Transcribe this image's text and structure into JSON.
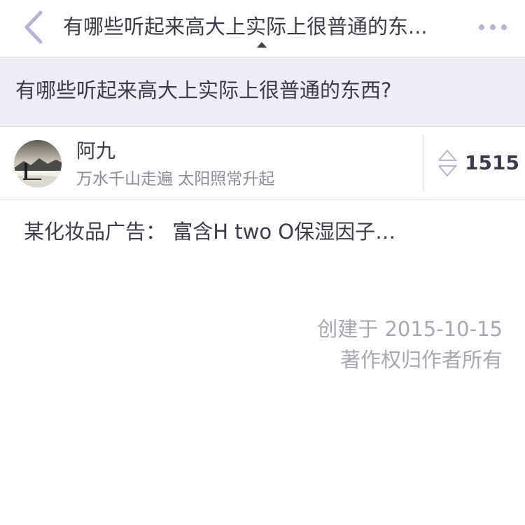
{
  "nav": {
    "title": "有哪些听起来高大上实际上很普通的东...",
    "back_icon": "back-chevron-icon",
    "more_icon": "more-dots-icon",
    "accent_color": "#b8b3d6"
  },
  "question": {
    "title": "有哪些听起来高大上实际上很普通的东西?"
  },
  "author": {
    "name": "阿九",
    "bio": "万水千山走遍 太阳照常升起",
    "avatar_icon": "avatar-photo"
  },
  "vote": {
    "count": "1515",
    "icon": "vote-arrows-icon"
  },
  "answer": {
    "text": "某化妆品广告： 富含H two O保湿因子…"
  },
  "meta": {
    "created": "创建于 2015-10-15",
    "copyright": "著作权归作者所有"
  }
}
